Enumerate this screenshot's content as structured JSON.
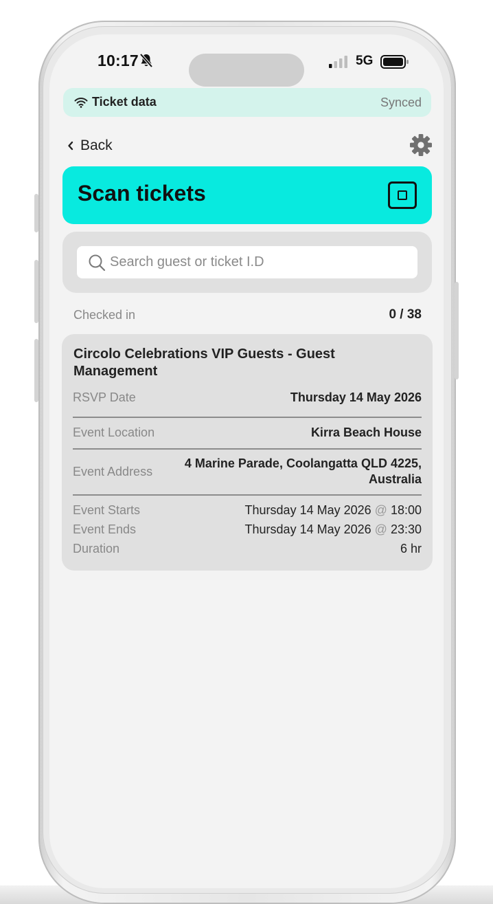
{
  "status_bar": {
    "time": "10:17",
    "network": "5G",
    "icons": [
      "bell-slash-icon",
      "signal-icon",
      "battery-icon"
    ]
  },
  "sync": {
    "icon": "wifi-icon",
    "title": "Ticket data",
    "status": "Synced",
    "color": "#d4f3ec"
  },
  "nav": {
    "back_label": "Back",
    "settings_icon": "gear-icon"
  },
  "header": {
    "title": "Scan tickets",
    "accent": "#08eadf",
    "scan_icon": "scan-square-icon"
  },
  "search": {
    "placeholder": "Search guest or ticket I.D",
    "value": ""
  },
  "checkin": {
    "label": "Checked in",
    "count": "0 / 38"
  },
  "event": {
    "title": "Circolo Celebrations VIP Guests - Guest Management",
    "rsvp": {
      "label": "RSVP Date",
      "value": "Thursday 14 May 2026"
    },
    "location": {
      "label": "Event Location",
      "value": "Kirra Beach House"
    },
    "address": {
      "label": "Event Address",
      "line1": "4 Marine Parade, Coolangatta QLD 4225,",
      "line2": "Australia"
    },
    "starts": {
      "label": "Event Starts",
      "date": "Thursday 14 May 2026",
      "at": "@",
      "time": "18:00"
    },
    "ends": {
      "label": "Event Ends",
      "date": "Thursday 14 May 2026",
      "at": "@",
      "time": "23:30"
    },
    "duration": {
      "label": "Duration",
      "value": "6 hr"
    }
  }
}
